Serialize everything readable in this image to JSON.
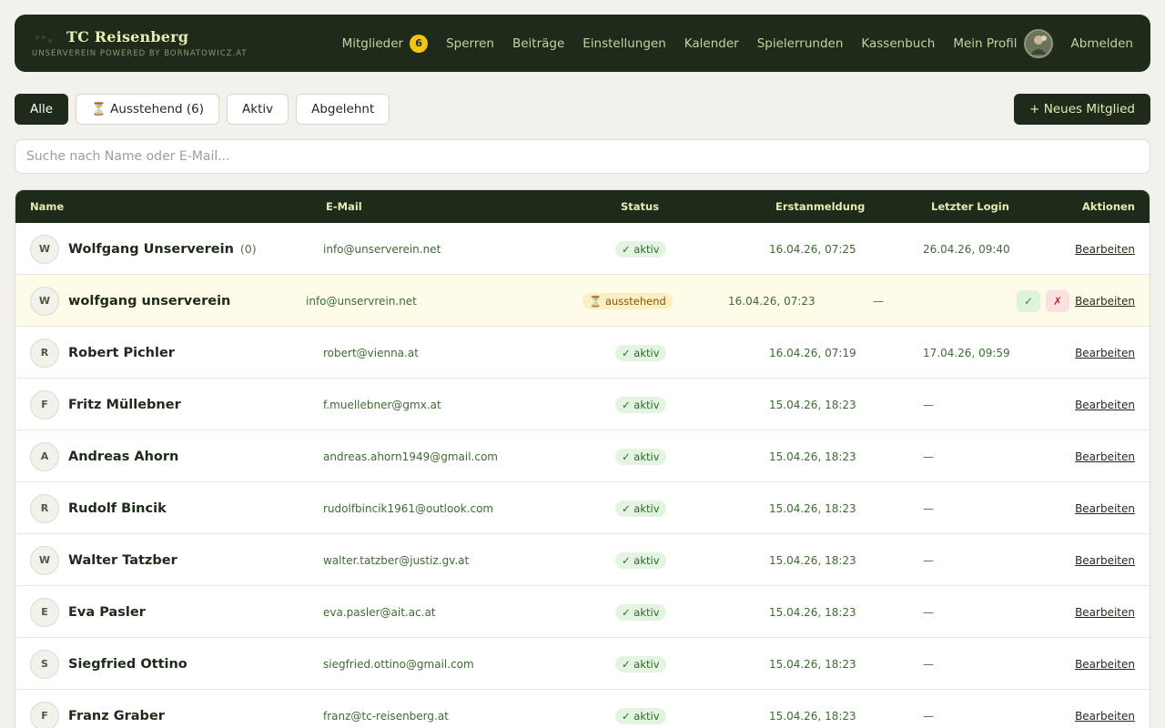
{
  "header": {
    "title": "TC Reisenberg",
    "subtitle": "Unserverein powered by bornatowicz.at",
    "nav": [
      {
        "label": "Mitglieder",
        "badge": "6"
      },
      {
        "label": "Sperren"
      },
      {
        "label": "Beiträge"
      },
      {
        "label": "Einstellungen"
      },
      {
        "label": "Kalender"
      },
      {
        "label": "Spielerrunden"
      },
      {
        "label": "Kassenbuch"
      },
      {
        "label": "Mein Profil"
      },
      {
        "label": "Abmelden"
      }
    ]
  },
  "filters": [
    "Alle",
    "⏳ Ausstehend (6)",
    "Aktiv",
    "Abgelehnt"
  ],
  "new_member_label": "+ Neues Mitglied",
  "search": {
    "placeholder": "Suche nach Name oder E-Mail...",
    "value": ""
  },
  "table": {
    "columns": [
      "Name",
      "E-Mail",
      "Status",
      "Erstanmeldung",
      "Letzter Login",
      "Aktionen"
    ],
    "edit_label": "Bearbeiten",
    "approve_label": "✓",
    "reject_label": "✗",
    "rows": [
      {
        "initial": "W",
        "name": "Wolfgang Unserverein",
        "extra": "(0)",
        "email": "info@unserverein.net",
        "status": "✓ aktiv",
        "status_type": "aktiv",
        "first": "16.04.26, 07:25",
        "last": "26.04.26, 09:40"
      },
      {
        "initial": "W",
        "name": "wolfgang unserverein",
        "extra": "",
        "email": "info@unservrein.net",
        "status": "⏳ ausstehend",
        "status_type": "pending",
        "first": "16.04.26, 07:23",
        "last": "—"
      },
      {
        "initial": "R",
        "name": "Robert Pichler",
        "extra": "",
        "email": "robert@vienna.at",
        "status": "✓ aktiv",
        "status_type": "aktiv",
        "first": "16.04.26, 07:19",
        "last": "17.04.26, 09:59"
      },
      {
        "initial": "F",
        "name": "Fritz Müllebner",
        "extra": "",
        "email": "f.muellebner@gmx.at",
        "status": "✓ aktiv",
        "status_type": "aktiv",
        "first": "15.04.26, 18:23",
        "last": "—"
      },
      {
        "initial": "A",
        "name": "Andreas Ahorn",
        "extra": "",
        "email": "andreas.ahorn1949@gmail.com",
        "status": "✓ aktiv",
        "status_type": "aktiv",
        "first": "15.04.26, 18:23",
        "last": "—"
      },
      {
        "initial": "R",
        "name": "Rudolf Bincik",
        "extra": "",
        "email": "rudolfbincik1961@outlook.com",
        "status": "✓ aktiv",
        "status_type": "aktiv",
        "first": "15.04.26, 18:23",
        "last": "—"
      },
      {
        "initial": "W",
        "name": "Walter Tatzber",
        "extra": "",
        "email": "walter.tatzber@justiz.gv.at",
        "status": "✓ aktiv",
        "status_type": "aktiv",
        "first": "15.04.26, 18:23",
        "last": "—"
      },
      {
        "initial": "E",
        "name": "Eva Pasler",
        "extra": "",
        "email": "eva.pasler@ait.ac.at",
        "status": "✓ aktiv",
        "status_type": "aktiv",
        "first": "15.04.26, 18:23",
        "last": "—"
      },
      {
        "initial": "S",
        "name": "Siegfried Ottino",
        "extra": "",
        "email": "siegfried.ottino@gmail.com",
        "status": "✓ aktiv",
        "status_type": "aktiv",
        "first": "15.04.26, 18:23",
        "last": "—"
      },
      {
        "initial": "F",
        "name": "Franz Graber",
        "extra": "",
        "email": "franz@tc-reisenberg.at",
        "status": "✓ aktiv",
        "status_type": "aktiv",
        "first": "15.04.26, 18:23",
        "last": "—"
      }
    ]
  },
  "colors": {
    "brand_dark": "#1e2a1a",
    "brand_light": "#e6ecb4",
    "badge": "#f2c417",
    "active_bg": "#e3f4e0",
    "pending_bg": "#fbeec3"
  }
}
